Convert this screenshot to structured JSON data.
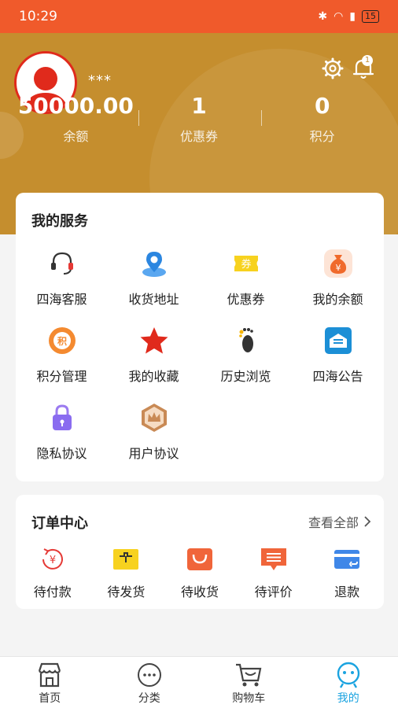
{
  "status_bar": {
    "time": "10:29",
    "battery": "15"
  },
  "profile": {
    "username": "***",
    "notification_count": "1"
  },
  "stats": [
    {
      "value": "50000.00",
      "label": "余额"
    },
    {
      "value": "1",
      "label": "优惠券"
    },
    {
      "value": "0",
      "label": "积分"
    }
  ],
  "services": {
    "title": "我的服务",
    "items": [
      {
        "label": "四海客服",
        "icon": "headset-icon"
      },
      {
        "label": "收货地址",
        "icon": "location-pin-icon"
      },
      {
        "label": "优惠券",
        "icon": "coupon-icon"
      },
      {
        "label": "我的余额",
        "icon": "money-bag-icon"
      },
      {
        "label": "积分管理",
        "icon": "points-icon"
      },
      {
        "label": "我的收藏",
        "icon": "star-icon"
      },
      {
        "label": "历史浏览",
        "icon": "footprint-icon"
      },
      {
        "label": "四海公告",
        "icon": "announcement-icon"
      },
      {
        "label": "隐私协议",
        "icon": "lock-icon"
      },
      {
        "label": "用户协议",
        "icon": "crown-badge-icon"
      }
    ]
  },
  "orders": {
    "title": "订单中心",
    "view_all": "查看全部",
    "items": [
      {
        "label": "待付款",
        "icon": "yen-pending-icon"
      },
      {
        "label": "待发货",
        "icon": "package-icon"
      },
      {
        "label": "待收货",
        "icon": "shopping-bag-icon"
      },
      {
        "label": "待评价",
        "icon": "comment-icon"
      },
      {
        "label": "退款",
        "icon": "refund-card-icon"
      }
    ]
  },
  "tabbar": [
    {
      "label": "首页",
      "icon": "store-icon",
      "active": false
    },
    {
      "label": "分类",
      "icon": "category-dots-icon",
      "active": false
    },
    {
      "label": "购物车",
      "icon": "cart-icon",
      "active": false
    },
    {
      "label": "我的",
      "icon": "profile-face-icon",
      "active": true
    }
  ],
  "colors": {
    "status_bar": "#f05a2b",
    "header": "#c58e2e",
    "active_tab": "#1aa3e0"
  }
}
